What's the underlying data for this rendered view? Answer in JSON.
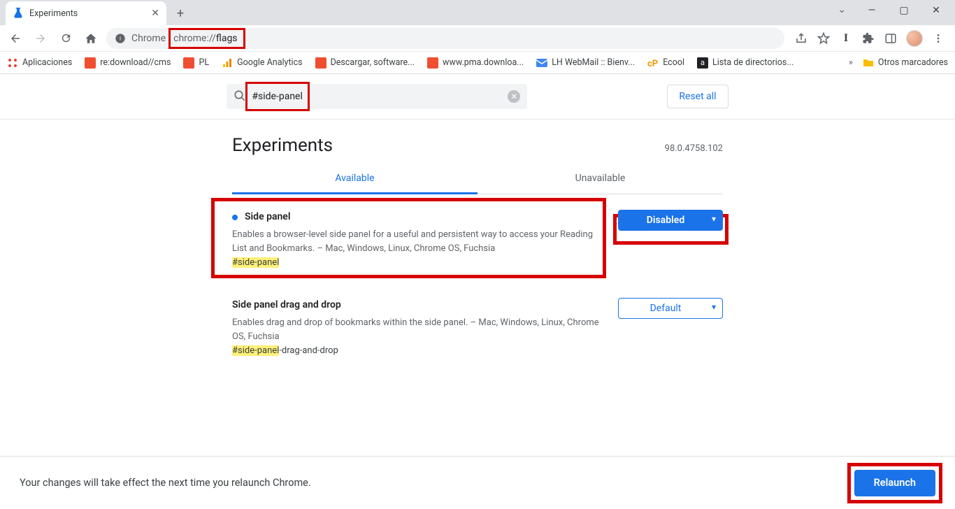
{
  "window": {
    "tab_title": "Experiments",
    "controls": {
      "min": "—",
      "max": "▢",
      "close": "✕"
    }
  },
  "toolbar": {
    "url_label": "Chrome",
    "url_dim": "chrome://",
    "url_strong": "flags"
  },
  "bookmarks": {
    "apps": "Aplicaciones",
    "items": [
      {
        "label": "re:download//cms"
      },
      {
        "label": "PL"
      },
      {
        "label": "Google Analytics"
      },
      {
        "label": "Descargar, software..."
      },
      {
        "label": "www.pma.downloa..."
      },
      {
        "label": "LH WebMail :: Bienv..."
      },
      {
        "label": "Ecool"
      },
      {
        "label": "Lista de directorios..."
      }
    ],
    "overflow": "»",
    "other": "Otros marcadores"
  },
  "page": {
    "search_value": "#side-panel",
    "reset_label": "Reset all",
    "heading": "Experiments",
    "version": "98.0.4758.102",
    "tabs": {
      "available": "Available",
      "unavailable": "Unavailable"
    },
    "flags": [
      {
        "title": "Side panel",
        "desc": "Enables a browser-level side panel for a useful and persistent way to access your Reading List and Bookmarks. – Mac, Windows, Linux, Chrome OS, Fuchsia",
        "hash_hl": "#side-panel",
        "hash_rest": "",
        "select": "Disabled",
        "modified": true
      },
      {
        "title": "Side panel drag and drop",
        "desc": "Enables drag and drop of bookmarks within the side panel. – Mac, Windows, Linux, Chrome OS, Fuchsia",
        "hash_hl": "#side-panel",
        "hash_rest": "-drag-and-drop",
        "select": "Default",
        "modified": false
      }
    ]
  },
  "footer": {
    "message": "Your changes will take effect the next time you relaunch Chrome.",
    "relaunch": "Relaunch"
  }
}
